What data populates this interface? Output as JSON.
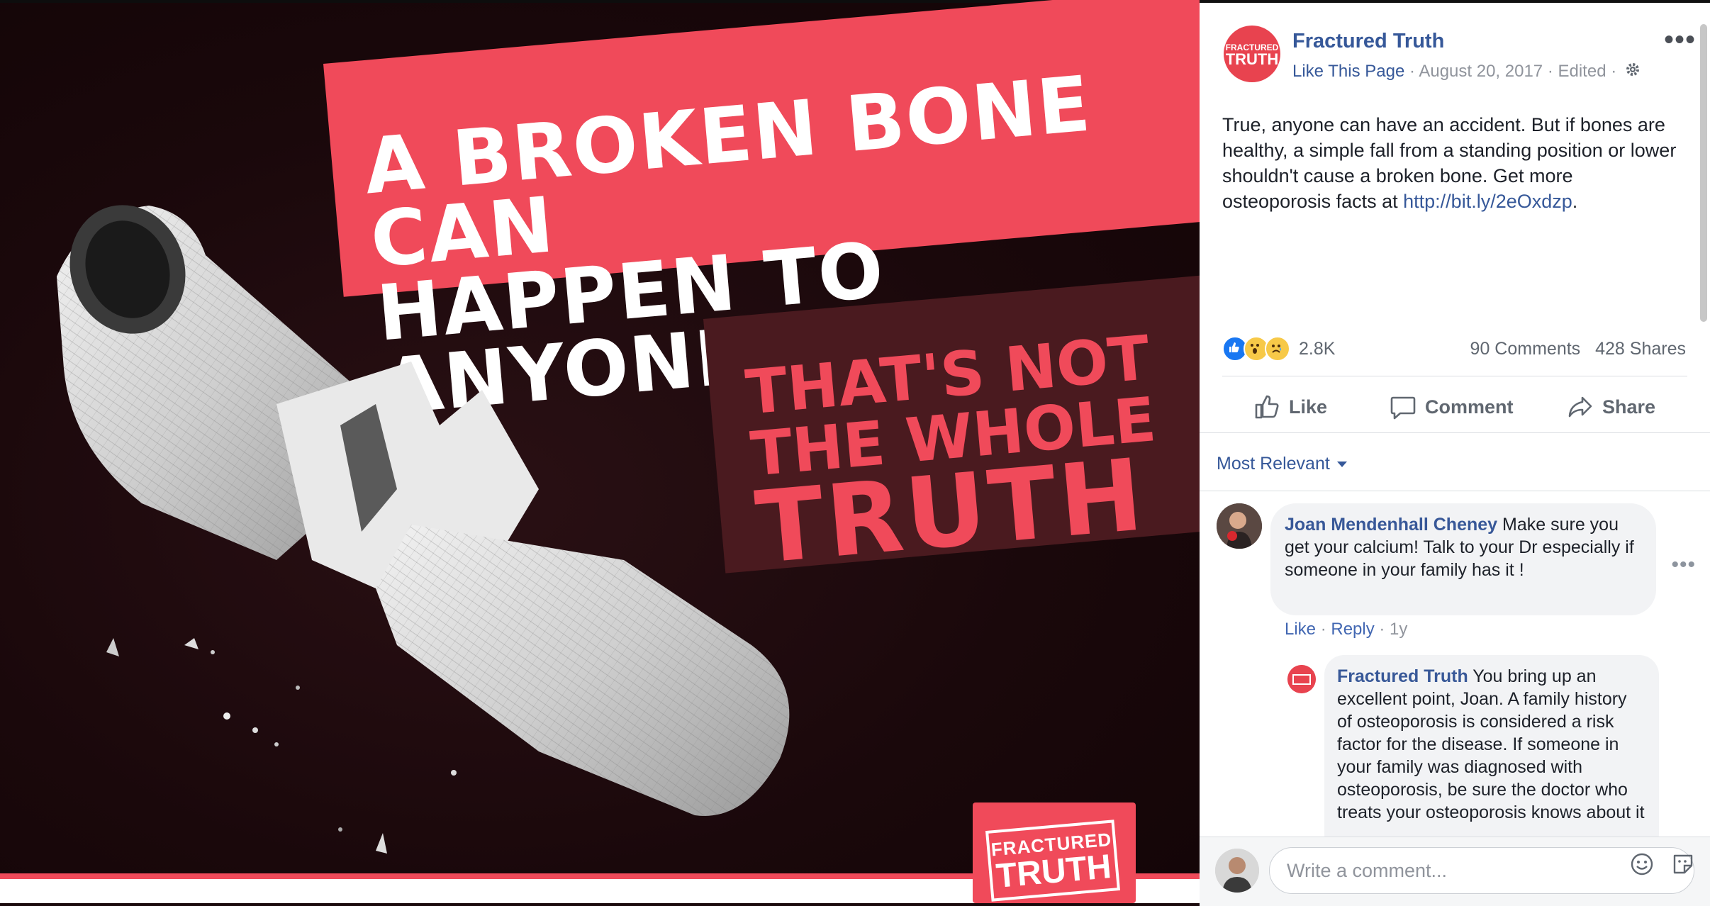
{
  "photo": {
    "headline_line1": "A BROKEN BONE CAN",
    "headline_line2": "HAPPEN TO ANYONE",
    "sub_line1": "THAT'S NOT",
    "sub_line2": "THE WHOLE",
    "sub_line3": "TRUTH",
    "logo_line1": "FRACTURED",
    "logo_line2": "TRUTH"
  },
  "post": {
    "avatar_line1": "FRACTURED",
    "avatar_line2": "TRUTH",
    "page_name": "Fractured Truth",
    "like_page": "Like This Page",
    "date": "August 20, 2017",
    "edited": "Edited",
    "sep": " · ",
    "text": "True, anyone can have an accident. But if bones are healthy, a simple fall from a standing position or lower shouldn't cause a broken bone. Get more osteoporosis facts at ",
    "link": "http://bit.ly/2eOxdzp",
    "text_end": ".",
    "reaction_count": "2.8K",
    "comments_count": "90 Comments",
    "shares_count": "428 Shares",
    "like_label": "Like",
    "comment_label": "Comment",
    "share_label": "Share",
    "more_icon": "more-dots-icon"
  },
  "comments": {
    "sort_label": "Most Relevant",
    "items": [
      {
        "author": "Joan Mendenhall Cheney",
        "text": " Make sure you get your calcium! Talk to your Dr especially if someone in your family has it !",
        "like": "Like",
        "reply": "Reply",
        "age": "1y"
      },
      {
        "author": "Fractured Truth",
        "text": " You bring up an excellent point, Joan. A family history of osteoporosis is considered a risk factor for the disease. If someone in your family was diagnosed with osteoporosis, be sure the doctor who treats your osteoporosis knows about it"
      }
    ]
  },
  "composer": {
    "placeholder": "Write a comment..."
  },
  "colors": {
    "brand_red": "#f04a5a",
    "link_blue": "#365899",
    "like_blue": "#1877f2"
  }
}
